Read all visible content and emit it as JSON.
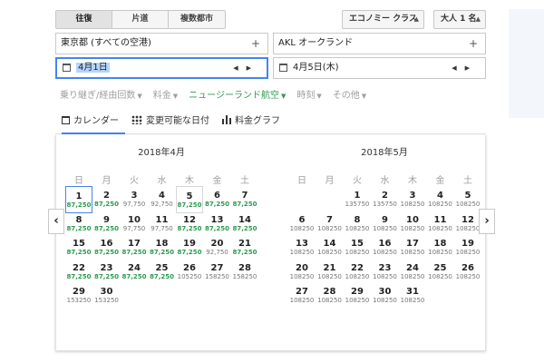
{
  "trip_tabs": [
    "往復",
    "片道",
    "複数都市"
  ],
  "cabin": "エコノミー クラス",
  "passengers": "大人 1 名",
  "origin": "東京都 (すべての空港)",
  "destination": "AKL オークランド",
  "depart_date": "4月1日",
  "return_date": "4月5日(木)",
  "filters": [
    "乗り継ぎ/経由回数",
    "料金",
    "ニュージーランド航空",
    "時刻",
    "その他"
  ],
  "view_tabs": [
    "カレンダー",
    "変更可能な日付",
    "料金グラフ"
  ],
  "weekdays": [
    "日",
    "月",
    "火",
    "水",
    "木",
    "金",
    "土"
  ],
  "colors": {
    "accent": "#4285f4",
    "low_price": "#2e9a4e"
  },
  "months": [
    {
      "title": "2018年4月",
      "offset": 0,
      "days": [
        {
          "d": "1",
          "p": "87,250",
          "low": true
        },
        {
          "d": "2",
          "p": "87,250",
          "low": true
        },
        {
          "d": "3",
          "p": "97,750",
          "low": false
        },
        {
          "d": "4",
          "p": "92,750",
          "low": false
        },
        {
          "d": "5",
          "p": "87,250",
          "low": true
        },
        {
          "d": "6",
          "p": "87,250",
          "low": true
        },
        {
          "d": "7",
          "p": "87,250",
          "low": true
        },
        {
          "d": "8",
          "p": "87,250",
          "low": true
        },
        {
          "d": "9",
          "p": "87,250",
          "low": true
        },
        {
          "d": "10",
          "p": "97,750",
          "low": false
        },
        {
          "d": "11",
          "p": "97,750",
          "low": false
        },
        {
          "d": "12",
          "p": "87,250",
          "low": true
        },
        {
          "d": "13",
          "p": "87,250",
          "low": true
        },
        {
          "d": "14",
          "p": "87,250",
          "low": true
        },
        {
          "d": "15",
          "p": "87,250",
          "low": true
        },
        {
          "d": "16",
          "p": "87,250",
          "low": true
        },
        {
          "d": "17",
          "p": "87,250",
          "low": true
        },
        {
          "d": "18",
          "p": "87,250",
          "low": true
        },
        {
          "d": "19",
          "p": "87,250",
          "low": true
        },
        {
          "d": "20",
          "p": "92,750",
          "low": false
        },
        {
          "d": "21",
          "p": "87,250",
          "low": true
        },
        {
          "d": "22",
          "p": "87,250",
          "low": true
        },
        {
          "d": "23",
          "p": "87,250",
          "low": true
        },
        {
          "d": "24",
          "p": "87,250",
          "low": true
        },
        {
          "d": "25",
          "p": "87,250",
          "low": true
        },
        {
          "d": "26",
          "p": "105250",
          "low": false
        },
        {
          "d": "27",
          "p": "158250",
          "low": false
        },
        {
          "d": "28",
          "p": "158250",
          "low": false
        },
        {
          "d": "29",
          "p": "153250",
          "low": false
        },
        {
          "d": "30",
          "p": "153250",
          "low": false
        }
      ]
    },
    {
      "title": "2018年5月",
      "offset": 2,
      "days": [
        {
          "d": "1",
          "p": "135750",
          "low": false
        },
        {
          "d": "2",
          "p": "135750",
          "low": false
        },
        {
          "d": "3",
          "p": "108250",
          "low": false
        },
        {
          "d": "4",
          "p": "108250",
          "low": false
        },
        {
          "d": "5",
          "p": "108250",
          "low": false
        },
        {
          "d": "6",
          "p": "108250",
          "low": false
        },
        {
          "d": "7",
          "p": "108250",
          "low": false
        },
        {
          "d": "8",
          "p": "108250",
          "low": false
        },
        {
          "d": "9",
          "p": "108250",
          "low": false
        },
        {
          "d": "10",
          "p": "108250",
          "low": false
        },
        {
          "d": "11",
          "p": "108250",
          "low": false
        },
        {
          "d": "12",
          "p": "108250",
          "low": false
        },
        {
          "d": "13",
          "p": "108250",
          "low": false
        },
        {
          "d": "14",
          "p": "108250",
          "low": false
        },
        {
          "d": "15",
          "p": "108250",
          "low": false
        },
        {
          "d": "16",
          "p": "108250",
          "low": false
        },
        {
          "d": "17",
          "p": "108250",
          "low": false
        },
        {
          "d": "18",
          "p": "108250",
          "low": false
        },
        {
          "d": "19",
          "p": "108250",
          "low": false
        },
        {
          "d": "20",
          "p": "108250",
          "low": false
        },
        {
          "d": "21",
          "p": "108250",
          "low": false
        },
        {
          "d": "22",
          "p": "108250",
          "low": false
        },
        {
          "d": "23",
          "p": "108250",
          "low": false
        },
        {
          "d": "24",
          "p": "108250",
          "low": false
        },
        {
          "d": "25",
          "p": "108250",
          "low": false
        },
        {
          "d": "26",
          "p": "108250",
          "low": false
        },
        {
          "d": "27",
          "p": "108250",
          "low": false
        },
        {
          "d": "28",
          "p": "108250",
          "low": false
        },
        {
          "d": "29",
          "p": "108250",
          "low": false
        },
        {
          "d": "30",
          "p": "108250",
          "low": false
        },
        {
          "d": "31",
          "p": "108250",
          "low": false
        }
      ]
    }
  ]
}
